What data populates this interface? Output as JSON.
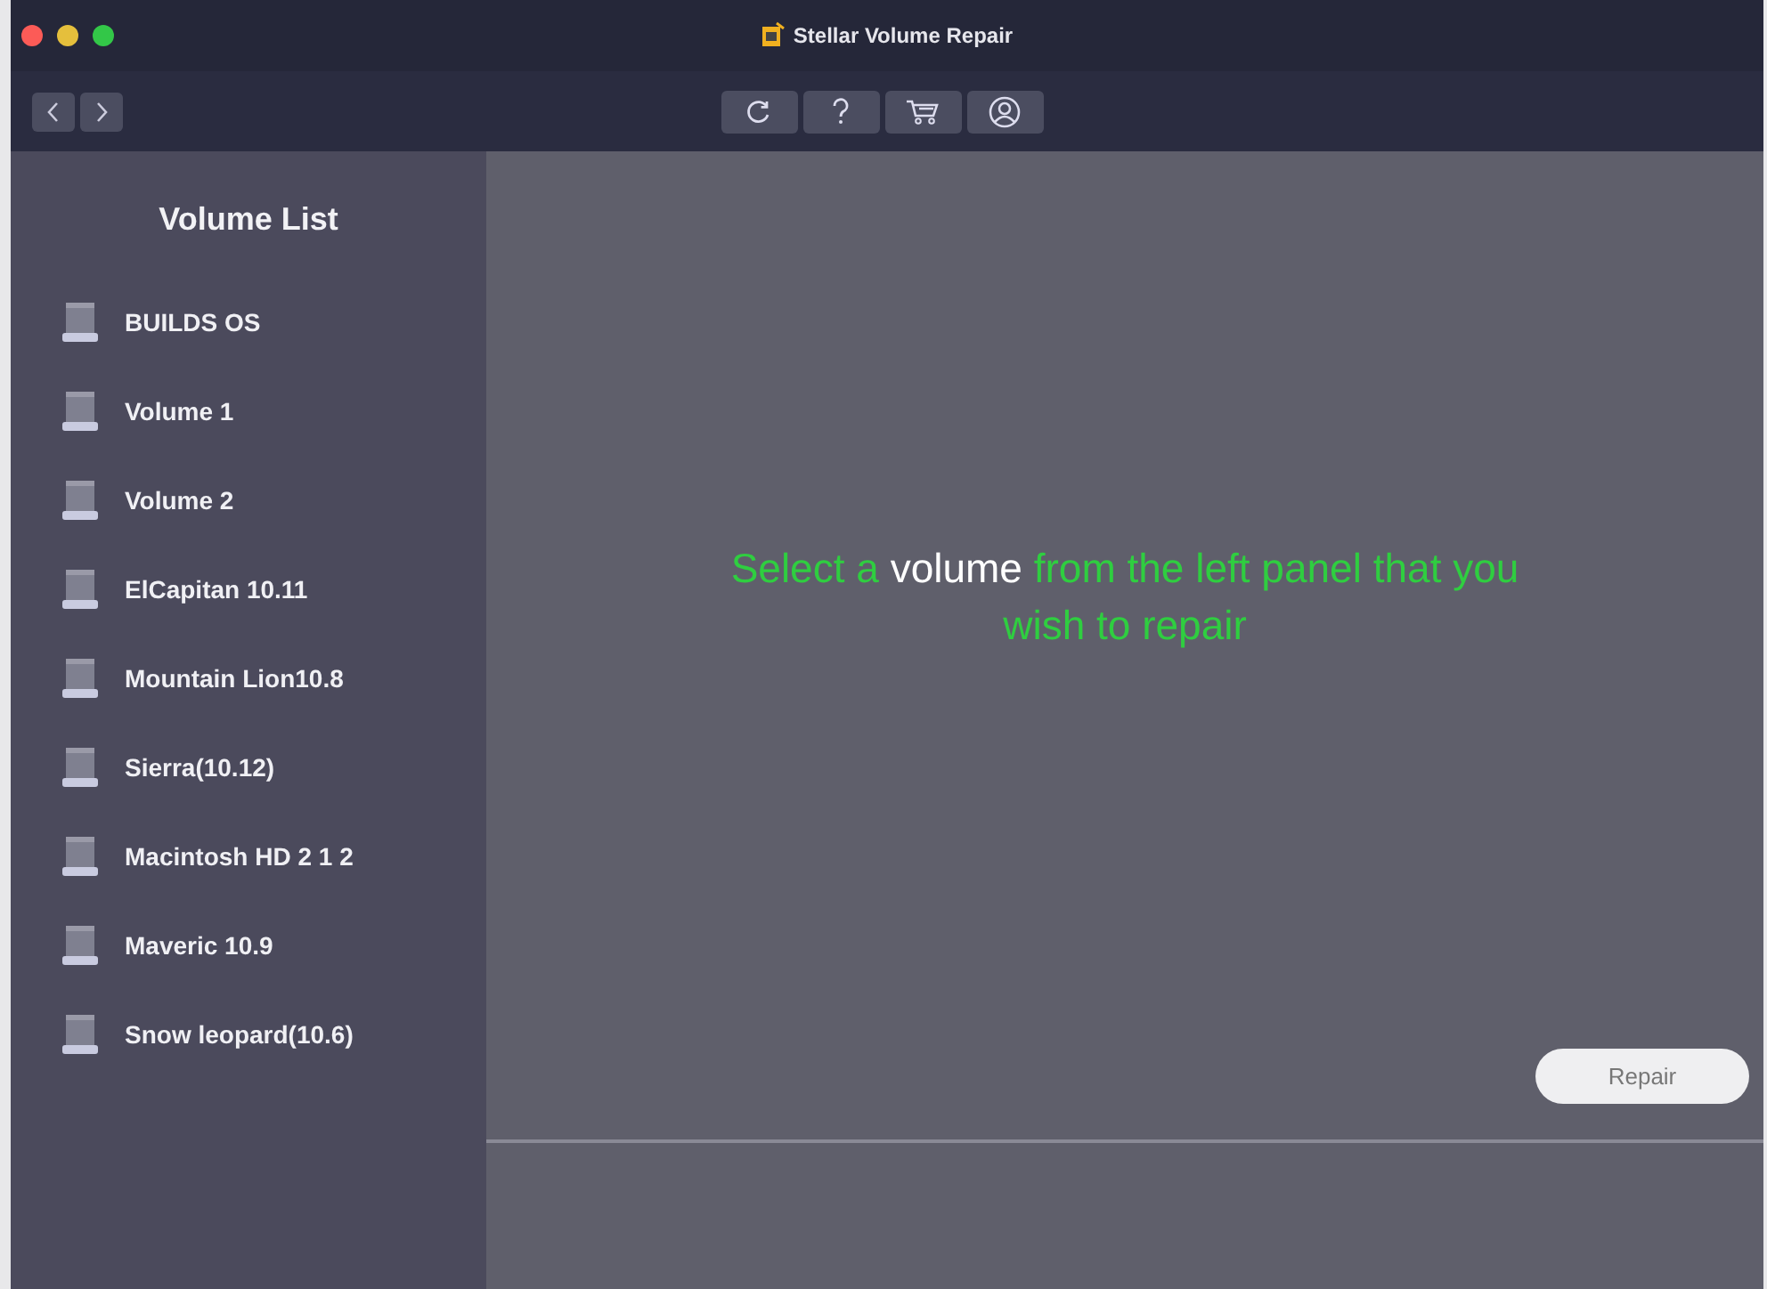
{
  "window": {
    "title": "Stellar Volume Repair"
  },
  "sidebar": {
    "title": "Volume List",
    "items": [
      {
        "label": "BUILDS OS"
      },
      {
        "label": "Volume 1"
      },
      {
        "label": "Volume 2"
      },
      {
        "label": "ElCapitan 10.11"
      },
      {
        "label": "Mountain Lion10.8"
      },
      {
        "label": "Sierra(10.12)"
      },
      {
        "label": "Macintosh HD 2 1 2"
      },
      {
        "label": "Maveric 10.9"
      },
      {
        "label": "Snow leopard(10.6)"
      }
    ]
  },
  "message": {
    "parts": [
      {
        "text": "Select a ",
        "highlight": false
      },
      {
        "text": "volume",
        "highlight": true
      },
      {
        "text": " from the left panel that you wish to repair",
        "highlight": false
      }
    ]
  },
  "repair_button": {
    "label": "Repair"
  }
}
